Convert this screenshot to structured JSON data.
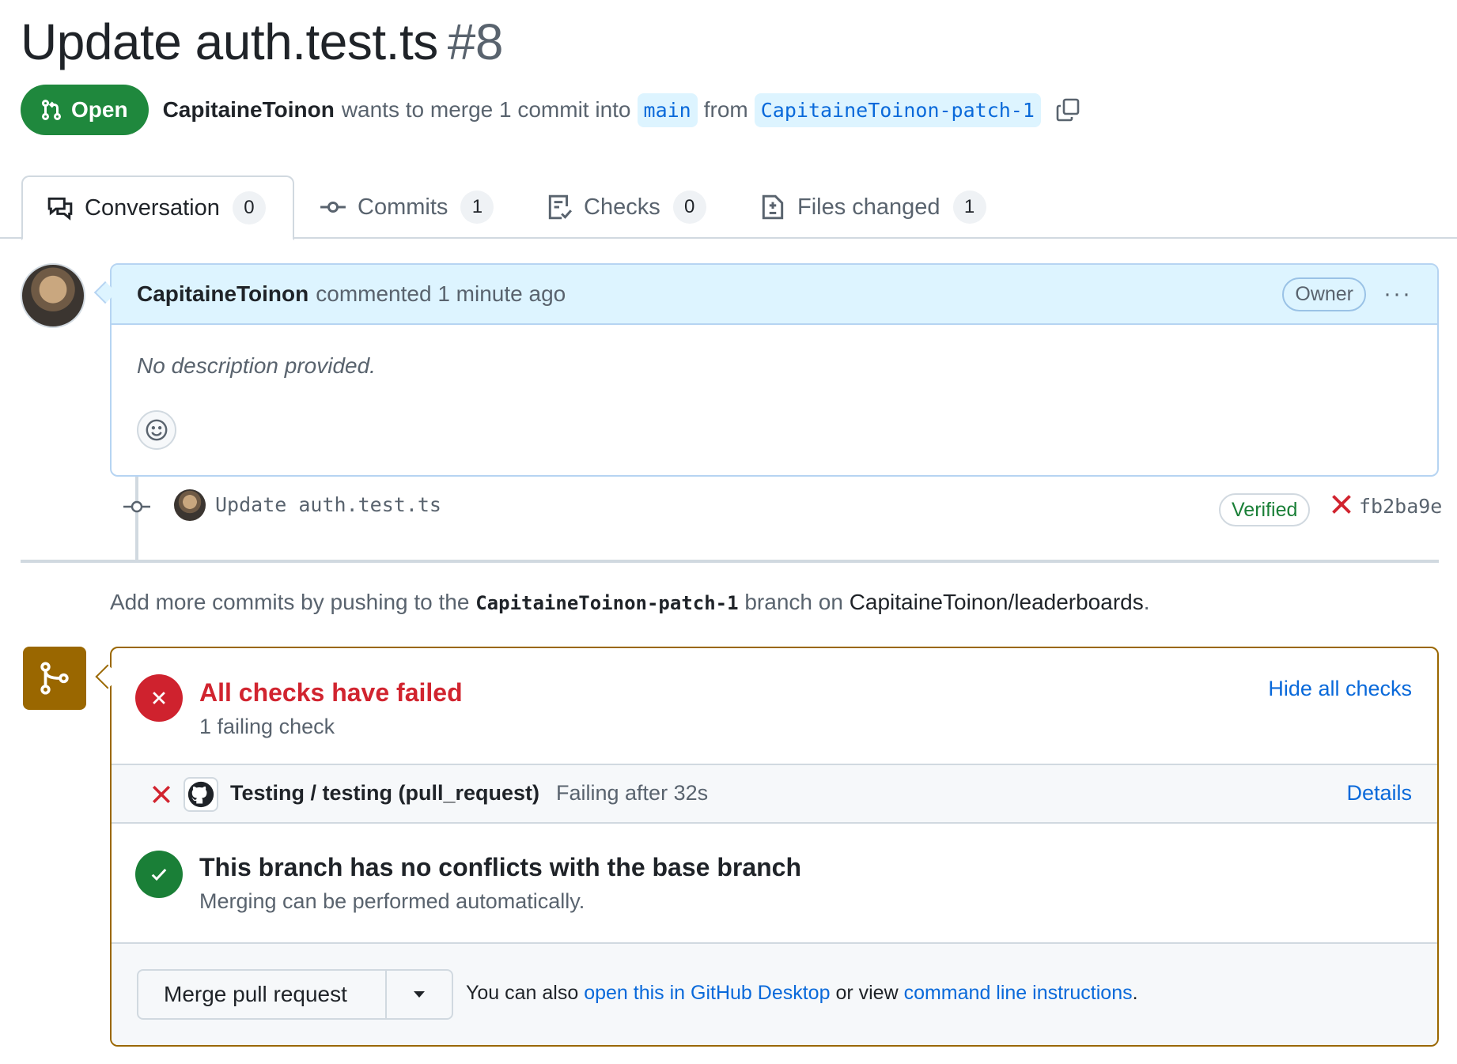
{
  "pr": {
    "title": "Update auth.test.ts",
    "number": "#8",
    "state": "Open",
    "author": "CapitaineToinon",
    "merge_text": "wants to merge 1 commit into",
    "base_branch": "main",
    "from_text": "from",
    "head_branch": "CapitaineToinon-patch-1"
  },
  "tabs": [
    {
      "label": "Conversation",
      "count": "0",
      "icon": "comment-discussion-icon"
    },
    {
      "label": "Commits",
      "count": "1",
      "icon": "git-commit-icon"
    },
    {
      "label": "Checks",
      "count": "0",
      "icon": "checklist-icon"
    },
    {
      "label": "Files changed",
      "count": "1",
      "icon": "file-diff-icon"
    }
  ],
  "comment": {
    "author": "CapitaineToinon",
    "action": "commented 1 minute ago",
    "badge": "Owner",
    "more": "···",
    "body": "No description provided."
  },
  "commit": {
    "message": "Update auth.test.ts",
    "verified": "Verified",
    "sha": "fb2ba9e"
  },
  "push_hint": {
    "prefix": "Add more commits by pushing to the",
    "branch": "CapitaineToinon-patch-1",
    "middle": "branch on",
    "repo": "CapitaineToinon/leaderboards",
    "suffix": "."
  },
  "checks": {
    "title": "All checks have failed",
    "subtitle": "1 failing check",
    "hide_link": "Hide all checks",
    "rows": [
      {
        "name": "Testing / testing (pull_request)",
        "status": "Failing after 32s",
        "details": "Details"
      }
    ]
  },
  "conflicts": {
    "title": "This branch has no conflicts with the base branch",
    "subtitle": "Merging can be performed automatically."
  },
  "merge": {
    "button": "Merge pull request",
    "also_text": "You can also",
    "desktop_link": "open this in GitHub Desktop",
    "or_text": "or view",
    "cli_link": "command line instructions",
    "end": "."
  },
  "colors": {
    "open_green": "#1f883d",
    "fail_red": "#cf222e",
    "success_green": "#1a7f37",
    "merge_box_border": "#9a6700",
    "link_blue": "#0969da"
  }
}
